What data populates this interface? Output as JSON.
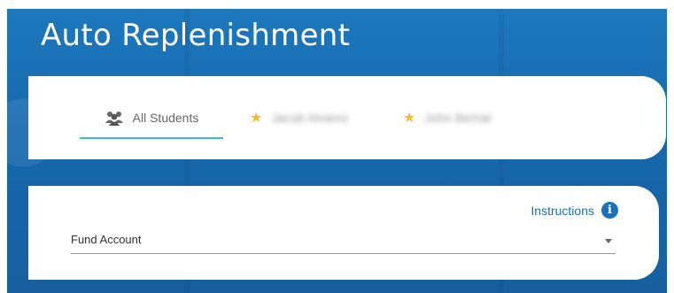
{
  "page": {
    "title": "Auto Replenishment"
  },
  "tabs": [
    {
      "label": "All Students",
      "icon": "users-icon",
      "active": true
    },
    {
      "label": "Jacob Alvarez",
      "icon": "star-icon",
      "blurred": true
    },
    {
      "label": "John Bernal",
      "icon": "star-icon",
      "blurred": true
    }
  ],
  "fund": {
    "instructions_label": "Instructions",
    "info_icon": "i",
    "select_label": "Fund Account"
  },
  "colors": {
    "background": "#1a6fb5",
    "accent": "#43b3e6",
    "link": "#1a73b8",
    "star": "#f5b82e"
  }
}
